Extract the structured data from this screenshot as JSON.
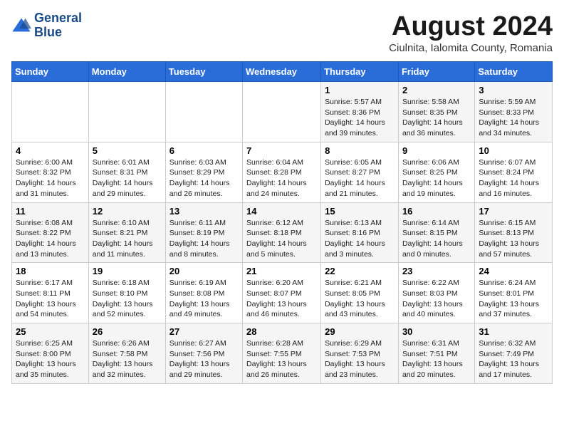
{
  "logo": {
    "line1": "General",
    "line2": "Blue"
  },
  "title": "August 2024",
  "subtitle": "Ciulnita, Ialomita County, Romania",
  "days_of_week": [
    "Sunday",
    "Monday",
    "Tuesday",
    "Wednesday",
    "Thursday",
    "Friday",
    "Saturday"
  ],
  "weeks": [
    [
      {
        "day": "",
        "content": ""
      },
      {
        "day": "",
        "content": ""
      },
      {
        "day": "",
        "content": ""
      },
      {
        "day": "",
        "content": ""
      },
      {
        "day": "1",
        "content": "Sunrise: 5:57 AM\nSunset: 8:36 PM\nDaylight: 14 hours and 39 minutes."
      },
      {
        "day": "2",
        "content": "Sunrise: 5:58 AM\nSunset: 8:35 PM\nDaylight: 14 hours and 36 minutes."
      },
      {
        "day": "3",
        "content": "Sunrise: 5:59 AM\nSunset: 8:33 PM\nDaylight: 14 hours and 34 minutes."
      }
    ],
    [
      {
        "day": "4",
        "content": "Sunrise: 6:00 AM\nSunset: 8:32 PM\nDaylight: 14 hours and 31 minutes."
      },
      {
        "day": "5",
        "content": "Sunrise: 6:01 AM\nSunset: 8:31 PM\nDaylight: 14 hours and 29 minutes."
      },
      {
        "day": "6",
        "content": "Sunrise: 6:03 AM\nSunset: 8:29 PM\nDaylight: 14 hours and 26 minutes."
      },
      {
        "day": "7",
        "content": "Sunrise: 6:04 AM\nSunset: 8:28 PM\nDaylight: 14 hours and 24 minutes."
      },
      {
        "day": "8",
        "content": "Sunrise: 6:05 AM\nSunset: 8:27 PM\nDaylight: 14 hours and 21 minutes."
      },
      {
        "day": "9",
        "content": "Sunrise: 6:06 AM\nSunset: 8:25 PM\nDaylight: 14 hours and 19 minutes."
      },
      {
        "day": "10",
        "content": "Sunrise: 6:07 AM\nSunset: 8:24 PM\nDaylight: 14 hours and 16 minutes."
      }
    ],
    [
      {
        "day": "11",
        "content": "Sunrise: 6:08 AM\nSunset: 8:22 PM\nDaylight: 14 hours and 13 minutes."
      },
      {
        "day": "12",
        "content": "Sunrise: 6:10 AM\nSunset: 8:21 PM\nDaylight: 14 hours and 11 minutes."
      },
      {
        "day": "13",
        "content": "Sunrise: 6:11 AM\nSunset: 8:19 PM\nDaylight: 14 hours and 8 minutes."
      },
      {
        "day": "14",
        "content": "Sunrise: 6:12 AM\nSunset: 8:18 PM\nDaylight: 14 hours and 5 minutes."
      },
      {
        "day": "15",
        "content": "Sunrise: 6:13 AM\nSunset: 8:16 PM\nDaylight: 14 hours and 3 minutes."
      },
      {
        "day": "16",
        "content": "Sunrise: 6:14 AM\nSunset: 8:15 PM\nDaylight: 14 hours and 0 minutes."
      },
      {
        "day": "17",
        "content": "Sunrise: 6:15 AM\nSunset: 8:13 PM\nDaylight: 13 hours and 57 minutes."
      }
    ],
    [
      {
        "day": "18",
        "content": "Sunrise: 6:17 AM\nSunset: 8:11 PM\nDaylight: 13 hours and 54 minutes."
      },
      {
        "day": "19",
        "content": "Sunrise: 6:18 AM\nSunset: 8:10 PM\nDaylight: 13 hours and 52 minutes."
      },
      {
        "day": "20",
        "content": "Sunrise: 6:19 AM\nSunset: 8:08 PM\nDaylight: 13 hours and 49 minutes."
      },
      {
        "day": "21",
        "content": "Sunrise: 6:20 AM\nSunset: 8:07 PM\nDaylight: 13 hours and 46 minutes."
      },
      {
        "day": "22",
        "content": "Sunrise: 6:21 AM\nSunset: 8:05 PM\nDaylight: 13 hours and 43 minutes."
      },
      {
        "day": "23",
        "content": "Sunrise: 6:22 AM\nSunset: 8:03 PM\nDaylight: 13 hours and 40 minutes."
      },
      {
        "day": "24",
        "content": "Sunrise: 6:24 AM\nSunset: 8:01 PM\nDaylight: 13 hours and 37 minutes."
      }
    ],
    [
      {
        "day": "25",
        "content": "Sunrise: 6:25 AM\nSunset: 8:00 PM\nDaylight: 13 hours and 35 minutes."
      },
      {
        "day": "26",
        "content": "Sunrise: 6:26 AM\nSunset: 7:58 PM\nDaylight: 13 hours and 32 minutes."
      },
      {
        "day": "27",
        "content": "Sunrise: 6:27 AM\nSunset: 7:56 PM\nDaylight: 13 hours and 29 minutes."
      },
      {
        "day": "28",
        "content": "Sunrise: 6:28 AM\nSunset: 7:55 PM\nDaylight: 13 hours and 26 minutes."
      },
      {
        "day": "29",
        "content": "Sunrise: 6:29 AM\nSunset: 7:53 PM\nDaylight: 13 hours and 23 minutes."
      },
      {
        "day": "30",
        "content": "Sunrise: 6:31 AM\nSunset: 7:51 PM\nDaylight: 13 hours and 20 minutes."
      },
      {
        "day": "31",
        "content": "Sunrise: 6:32 AM\nSunset: 7:49 PM\nDaylight: 13 hours and 17 minutes."
      }
    ]
  ]
}
